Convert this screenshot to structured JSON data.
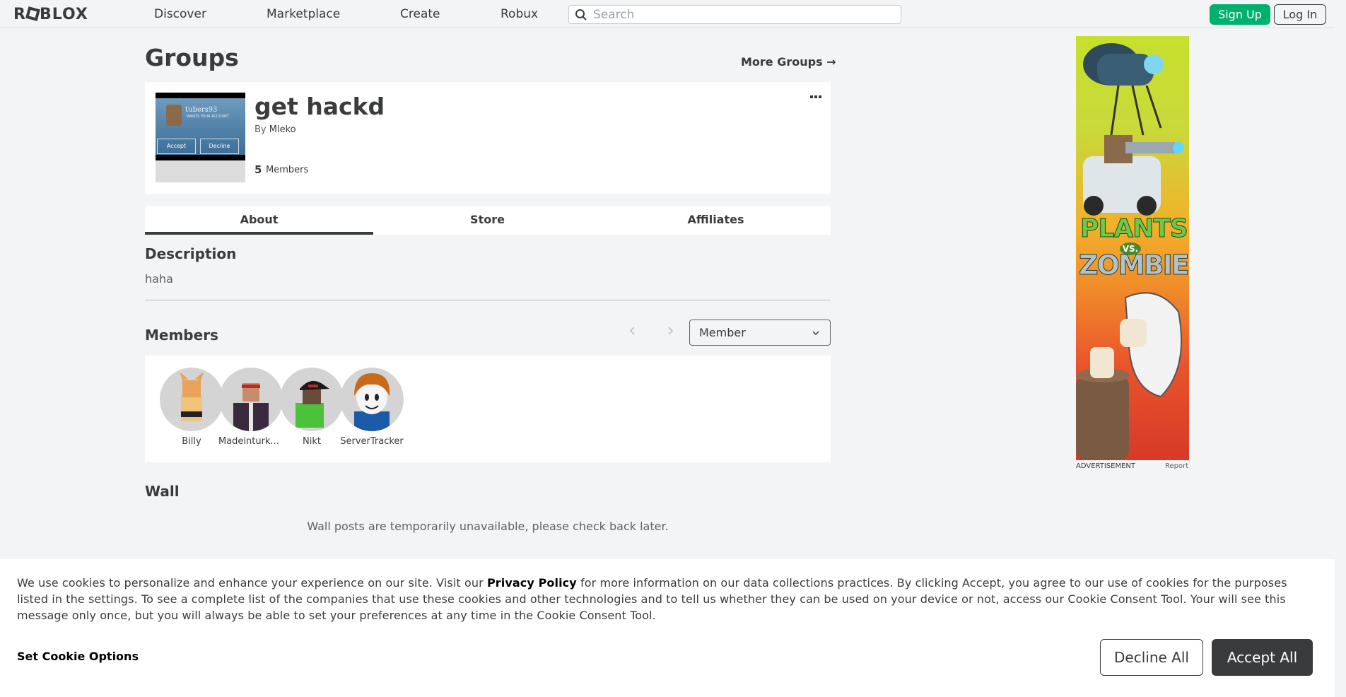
{
  "nav": {
    "logo": "ROBLOX",
    "links": [
      "Discover",
      "Marketplace",
      "Create",
      "Robux"
    ],
    "search_placeholder": "Search",
    "signup": "Sign Up",
    "login": "Log In"
  },
  "page": {
    "title": "Groups",
    "more_groups": "More Groups →"
  },
  "group": {
    "name": "get hackd",
    "by_label": "By",
    "owner": "Mleko",
    "member_count": "5",
    "member_label": "Members",
    "thumbnail": {
      "name": "tubers93",
      "subtitle": "WANTS YOUR ACCOUNT",
      "accept": "Accept",
      "decline": "Decline"
    }
  },
  "tabs": [
    "About",
    "Store",
    "Affiliates"
  ],
  "description": {
    "heading": "Description",
    "text": "haha"
  },
  "members": {
    "heading": "Members",
    "role": "Member",
    "list": [
      {
        "name": "Billy",
        "color": "#e8a25a"
      },
      {
        "name": "Madeinturke...",
        "color": "#3a2a3e"
      },
      {
        "name": "Nikt",
        "color": "#4cc13a"
      },
      {
        "name": "ServerTracker",
        "color": "#c86a1a"
      }
    ]
  },
  "wall": {
    "heading": "Wall",
    "message": "Wall posts are temporarily unavailable, please check back later."
  },
  "ad": {
    "title1": "PLANTS",
    "vs": "VS.",
    "title2": "ZOMBIES",
    "label": "ADVERTISEMENT",
    "report": "Report"
  },
  "cookie": {
    "text_pre": "We use cookies to personalize and enhance your experience on our site. Visit our ",
    "policy_link": "Privacy Policy",
    "text_post": " for more information on our data collections practices. By clicking Accept, you agree to our use of cookies for the purposes listed in the settings. To see a complete list of the companies that use these cookies and other technologies and to tell us whether they can be used on your device or not, access our Cookie Consent Tool. Your will see this message only once, but you will always be able to set your preferences at any time in the Cookie Consent Tool.",
    "options": "Set Cookie Options",
    "decline": "Decline All",
    "accept": "Accept All"
  }
}
